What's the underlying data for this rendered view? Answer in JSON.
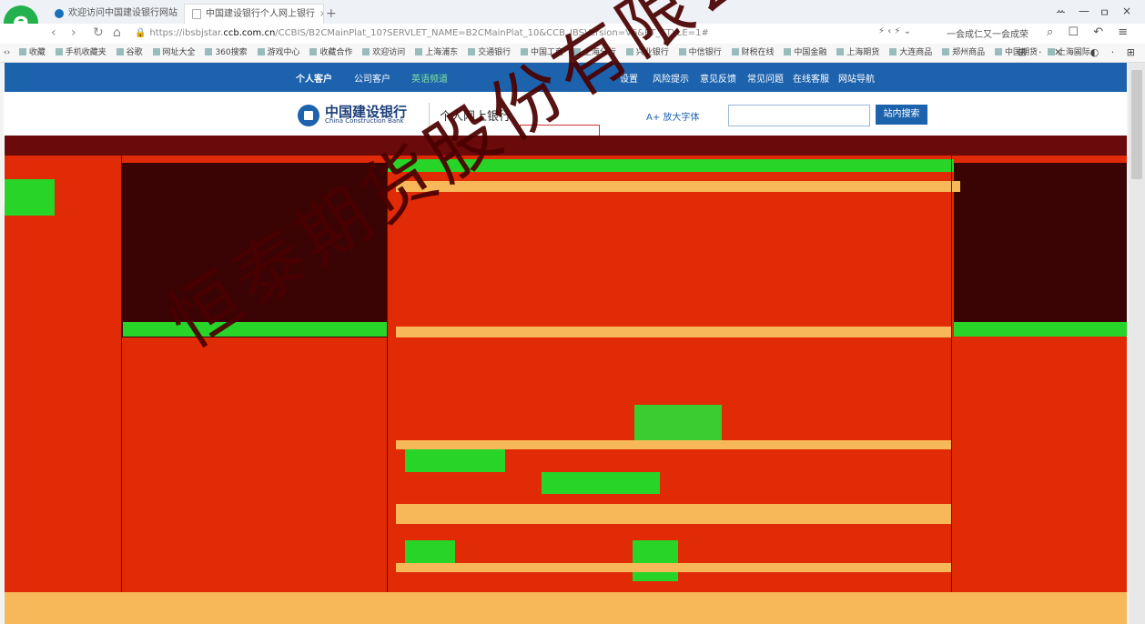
{
  "browser": {
    "tabs": [
      {
        "label": "欢迎访问中国建设银行网站"
      },
      {
        "label": "中国建设银行个人网上银行"
      }
    ],
    "new_tab": "+",
    "window_controls": [
      "ꕀ",
      "—",
      "ㅁ",
      "×"
    ],
    "nav": {
      "back": "‹",
      "forward": "›",
      "refresh": "↻",
      "home": "⌂"
    },
    "url": {
      "prefix": "https://ibsbjstar.",
      "host": "ccb.com.cn",
      "path": "/CCBIS/B2CMainPlat_10?SERVLET_NAME=B2CMainPlat_10&CCB_IBSVersion=V6&PT_STYLE=1#"
    },
    "address_right": "⚡ ‹ ⚡ ⌄",
    "search_engine": "一会成仁又一会成荣",
    "toolbar_icons": "⌕ ☐ ↶ ≡",
    "favorites": [
      "收藏",
      "手机收藏夹",
      "谷歌",
      "网址大全",
      "360搜索",
      "游戏中心",
      "收藏合作",
      "欢迎访问",
      "上海浦东",
      "交通银行",
      "中国工商",
      "上海分行",
      "兴业银行",
      "中信银行",
      "财税在线",
      "中国金融",
      "上海期货",
      "大连商品",
      "郑州商品",
      "中国期货",
      "上海国际"
    ],
    "favorites_right": "⊞ · ✕ · ◐ · ⊞"
  },
  "bank": {
    "topnav": {
      "personal": "个人客户",
      "corporate": "公司客户",
      "channel": "英语频道",
      "settings": "设置",
      "risk": "风险提示",
      "feedback": "意见反馈",
      "faq": "常见问题",
      "online": "在线客服",
      "sitemap": "网站导航"
    },
    "logo_cn": "中国建设银行",
    "logo_en": "China Construction Bank",
    "subtitle": "个人网上银行",
    "font_size": "A+ 放大字体",
    "search_placeholder": "",
    "search_button": "站内搜索"
  },
  "watermark": "恒泰期货股份有限公司",
  "colors": {
    "brand": "#1c62ad",
    "glitch": "#e12a06",
    "watermark": "#4a0000"
  }
}
